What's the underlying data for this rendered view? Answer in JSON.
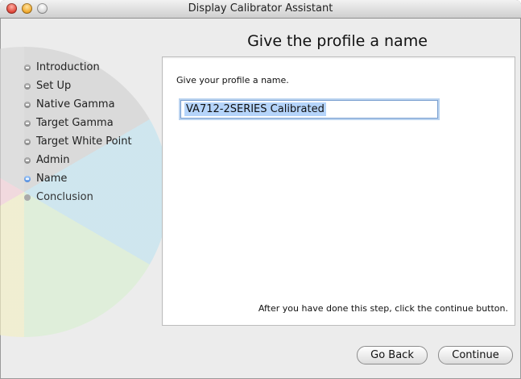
{
  "window": {
    "title": "Display Calibrator Assistant"
  },
  "heading": "Give the profile a name",
  "steps": [
    {
      "label": "Introduction",
      "state": "done"
    },
    {
      "label": "Set Up",
      "state": "done"
    },
    {
      "label": "Native Gamma",
      "state": "done"
    },
    {
      "label": "Target Gamma",
      "state": "done"
    },
    {
      "label": "Target White Point",
      "state": "done"
    },
    {
      "label": "Admin",
      "state": "done"
    },
    {
      "label": "Name",
      "state": "current"
    },
    {
      "label": "Conclusion",
      "state": "future"
    }
  ],
  "panel": {
    "prompt": "Give your profile a name.",
    "profile_name": "VA712-2SERIES Calibrated",
    "instructions": "After you have done this step, click the continue button."
  },
  "buttons": {
    "back": "Go Back",
    "continue": "Continue"
  }
}
